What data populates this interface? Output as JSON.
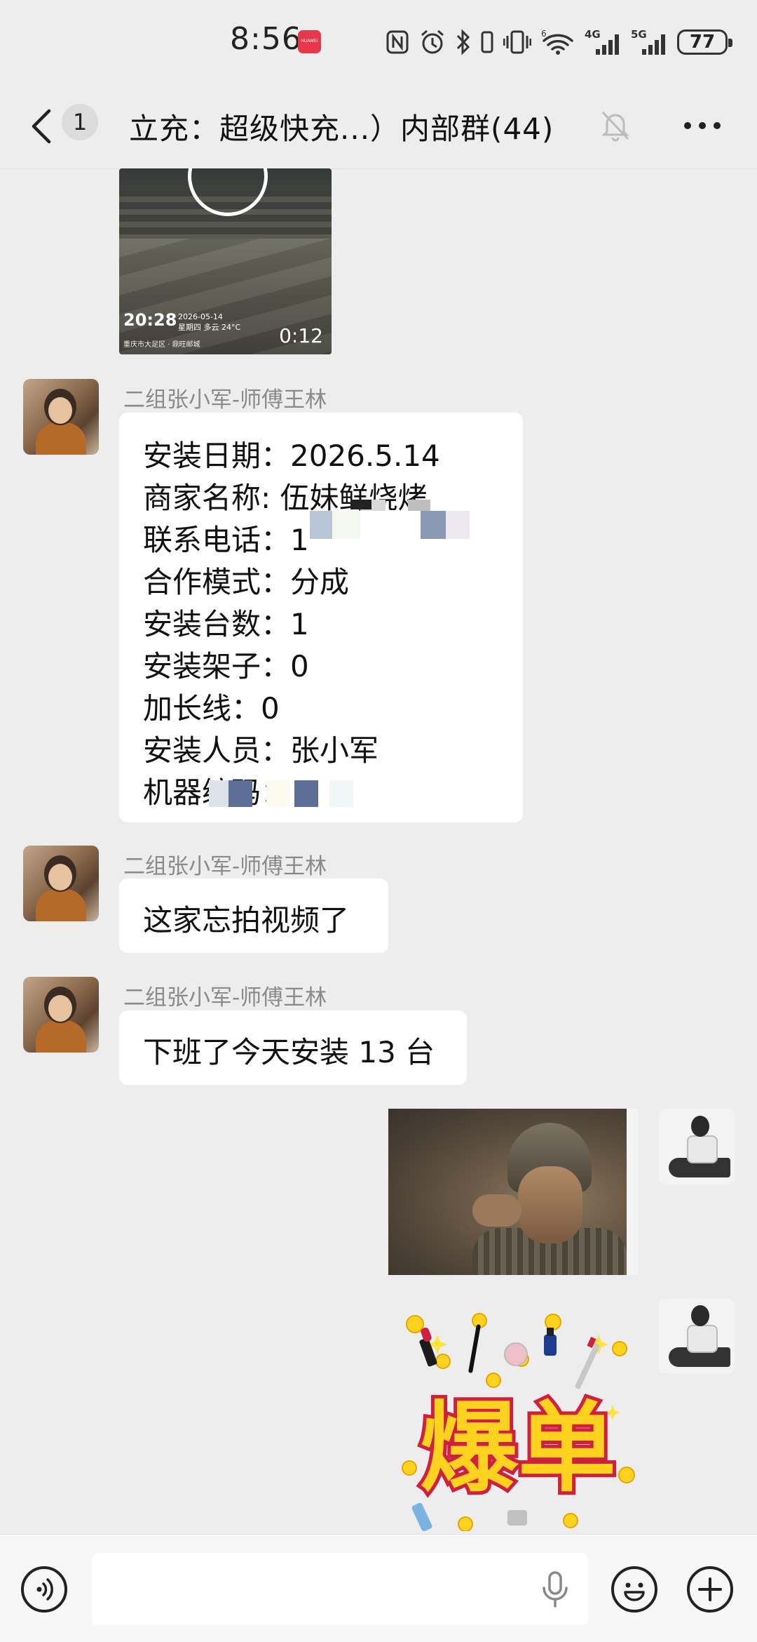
{
  "status_bar": {
    "time": "8:56",
    "brand_badge": "HUAWEI",
    "network_4g": "4G",
    "network_5g": "5G",
    "network_6": "6",
    "battery": "77"
  },
  "header": {
    "unread_count": "1",
    "title": "立充：超级快充...）内部群(44)"
  },
  "video_message": {
    "watermark_time": "20:28",
    "watermark_date": "2026-05-14",
    "watermark_weather": "星期四  多云 24°C",
    "watermark_place": "重庆市大足区 · 鼎旺邮城",
    "duration": "0:12"
  },
  "messages": [
    {
      "sender": "二组张小军-师傅王林",
      "form": [
        {
          "label": "安装日期：",
          "value": "2026.5.14"
        },
        {
          "label": "商家名称: ",
          "value": "伍妹鲜烧烤"
        },
        {
          "label": "联系电话：",
          "value": "1"
        },
        {
          "label": "合作模式：",
          "value": "分成"
        },
        {
          "label": "安装台数：",
          "value": "1"
        },
        {
          "label": "安装架子：",
          "value": "0"
        },
        {
          "label": "加长线：",
          "value": "0"
        },
        {
          "label": "安装人员：",
          "value": "张小军"
        },
        {
          "label": "机器编码：",
          "value": ""
        }
      ]
    },
    {
      "sender": "二组张小军-师傅王林",
      "text": "这家忘拍视频了"
    },
    {
      "sender": "二组张小军-师傅王林",
      "text": "下班了今天安装 13 台"
    }
  ],
  "sticker": {
    "text": "爆单"
  },
  "colors": {
    "background": "#ededed",
    "bubble": "#ffffff",
    "sender_text": "#8a8a8a",
    "blur_blue": "#5e6f96",
    "sticker_yellow": "#ffd21f",
    "sticker_red": "#e8374a"
  },
  "input": {
    "placeholder": ""
  }
}
